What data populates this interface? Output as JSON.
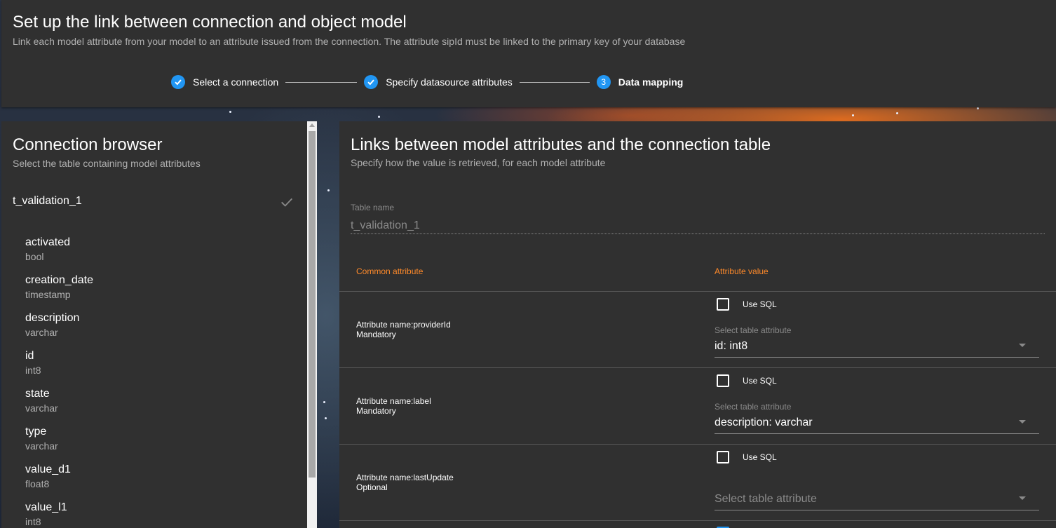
{
  "header": {
    "title": "Set up the link between connection and object model",
    "subtitle": "Link each model attribute from your model to an attribute issued from the connection. The attribute sipId must be linked to the primary key of your database"
  },
  "stepper": {
    "steps": [
      {
        "label": "Select a connection",
        "state": "done"
      },
      {
        "label": "Specify datasource attributes",
        "state": "done"
      },
      {
        "label": "Data mapping",
        "state": "active",
        "number": "3"
      }
    ]
  },
  "connection_browser": {
    "title": "Connection browser",
    "subtitle": "Select the table containing model attributes",
    "table": "t_validation_1",
    "columns": [
      {
        "name": "activated",
        "type": "bool"
      },
      {
        "name": "creation_date",
        "type": "timestamp"
      },
      {
        "name": "description",
        "type": "varchar"
      },
      {
        "name": "id",
        "type": "int8"
      },
      {
        "name": "state",
        "type": "varchar"
      },
      {
        "name": "type",
        "type": "varchar"
      },
      {
        "name": "value_d1",
        "type": "float8"
      },
      {
        "name": "value_l1",
        "type": "int8"
      }
    ]
  },
  "mapping": {
    "title": "Links between model attributes and the connection table",
    "subtitle": "Specify how the value is retrieved, for each model attribute",
    "table_name_label": "Table name",
    "table_name_value": "t_validation_1",
    "col_common": "Common attribute",
    "col_value": "Attribute value",
    "rows": [
      {
        "name": "Attribute name:providerId",
        "requirement": "Mandatory",
        "use_sql": "Use SQL",
        "select_label": "Select table attribute",
        "select_value": "id: int8"
      },
      {
        "name": "Attribute name:label",
        "requirement": "Mandatory",
        "use_sql": "Use SQL",
        "select_label": "Select table attribute",
        "select_value": "description: varchar"
      },
      {
        "name": "Attribute name:lastUpdate",
        "requirement": "Optional",
        "use_sql": "Use SQL",
        "select_placeholder": "Select table attribute"
      }
    ]
  },
  "colors": {
    "accent": "#2196f3",
    "header_text_orange": "#ff8a2a",
    "panel": "#303030"
  },
  "icons": [
    "check-circle-icon",
    "checkmark-icon",
    "dropdown-arrow-icon",
    "checkbox-icon"
  ]
}
